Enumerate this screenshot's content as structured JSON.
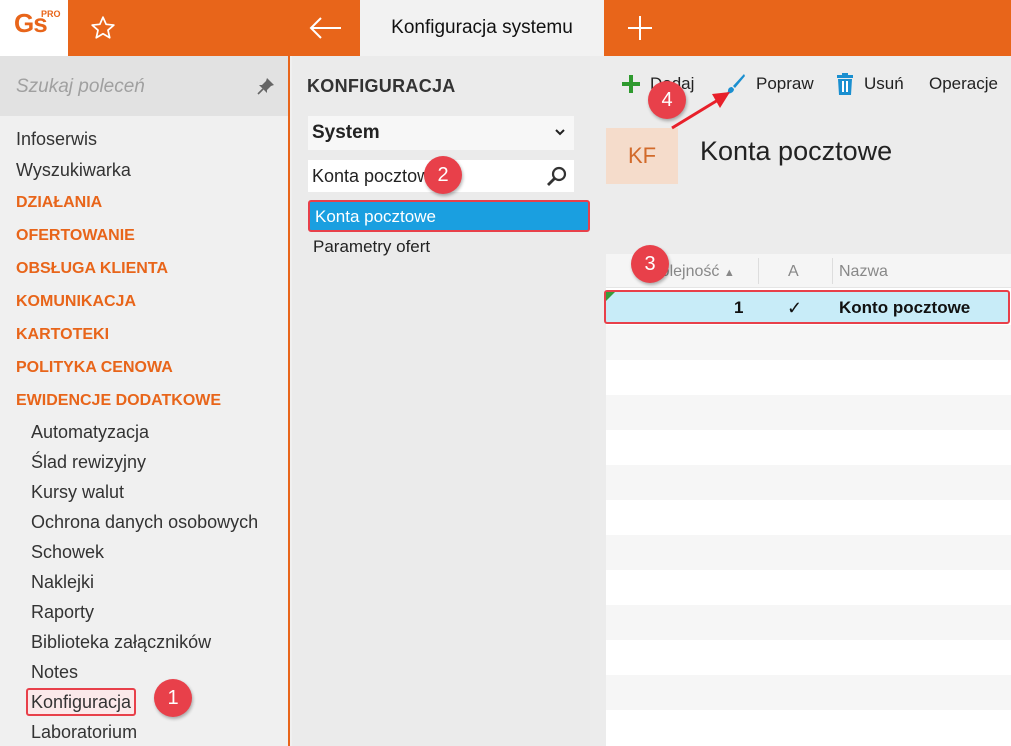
{
  "app": {
    "logo_text": "Gs",
    "logo_badge": "PRO",
    "active_tab": "Konfiguracja systemu"
  },
  "sidebar": {
    "search_placeholder": "Szukaj poleceń",
    "items": [
      {
        "label": "Infoserwis",
        "kind": "item"
      },
      {
        "label": "Wyszukiwarka",
        "kind": "item"
      },
      {
        "label": "DZIAŁANIA",
        "kind": "category"
      },
      {
        "label": "OFERTOWANIE",
        "kind": "category"
      },
      {
        "label": "OBSŁUGA KLIENTA",
        "kind": "category"
      },
      {
        "label": "KOMUNIKACJA",
        "kind": "category"
      },
      {
        "label": "KARTOTEKI",
        "kind": "category"
      },
      {
        "label": "POLITYKA CENOWA",
        "kind": "category"
      },
      {
        "label": "EWIDENCJE DODATKOWE",
        "kind": "category"
      }
    ],
    "sub_items": [
      "Automatyzacja",
      "Ślad rewizyjny",
      "Kursy walut",
      "Ochrona danych osobowych",
      "Schowek",
      "Naklejki",
      "Raporty",
      "Biblioteka załączników",
      "Notes",
      "Konfiguracja",
      "Laboratorium"
    ]
  },
  "middle": {
    "title": "KONFIGURACJA",
    "select_value": "System",
    "search_value": "Konta pocztowe",
    "list": [
      "Konta pocztowe",
      "Parametry ofert"
    ]
  },
  "right": {
    "toolbar": {
      "add": "Dodaj",
      "edit": "Popraw",
      "delete": "Usuń",
      "operations": "Operacje"
    },
    "badge": "KF",
    "title": "Konta pocztowe",
    "columns": [
      "Kolejność",
      "A",
      "Nazwa"
    ],
    "rows": [
      {
        "order": "1",
        "active": "✓",
        "name": "Konto pocztowe"
      }
    ]
  },
  "annotations": [
    "1",
    "2",
    "3",
    "4"
  ],
  "colors": {
    "accent": "#e8651a",
    "selection": "#1a9fe0",
    "annotation": "#e8404a"
  }
}
